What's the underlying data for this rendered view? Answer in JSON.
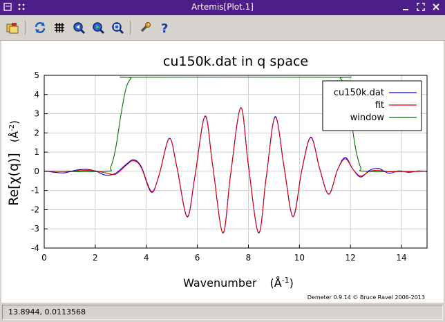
{
  "window": {
    "title": "Artemis[Plot.1]"
  },
  "toolbar": {
    "tools": [
      "open-files-icon",
      "refresh-icon",
      "grid-icon",
      "zoom-left-icon",
      "zoom-right-icon",
      "zoom-fit-icon",
      "settings-wrench-icon",
      "help-icon"
    ]
  },
  "status": {
    "coords": "13.8944,  0.0113568"
  },
  "colors": {
    "titlebar": "#4b1e8a",
    "data": "#0000ff",
    "fit": "#e00000",
    "window": "#007000"
  },
  "chart_data": {
    "type": "line",
    "title": "cu150k.dat in q space",
    "xlabel_main": "Wavenumber",
    "xlabel_unit_base": "(Å",
    "xlabel_unit_sup": "-1",
    "xlabel_unit_end": ")",
    "ylabel_main": "Re[χ(q)]",
    "ylabel_unit_base": "(Å",
    "ylabel_unit_sup": "-2",
    "ylabel_unit_end": ")",
    "xlim": [
      0,
      15
    ],
    "ylim": [
      -4,
      5
    ],
    "xticks": [
      0,
      2,
      4,
      6,
      8,
      10,
      12,
      14
    ],
    "yticks": [
      -4,
      -3,
      -2,
      -1,
      0,
      1,
      2,
      3,
      4,
      5
    ],
    "grid": true,
    "legend_position": "top-right",
    "credit": "Demeter 0.9.14 © Bruce Ravel 2006-2013",
    "series": [
      {
        "name": "cu150k.dat",
        "color": "#0000ff",
        "x": [
          0,
          0.4,
          0.8,
          1.2,
          1.6,
          2.0,
          2.4,
          2.8,
          3.2,
          3.5,
          3.8,
          4.2,
          4.5,
          4.9,
          5.2,
          5.6,
          5.9,
          6.3,
          6.6,
          7.0,
          7.3,
          7.7,
          8.0,
          8.4,
          8.7,
          9.05,
          9.4,
          9.75,
          10.1,
          10.45,
          10.8,
          11.15,
          11.5,
          11.8,
          12.1,
          12.4,
          12.75,
          13.1,
          13.5,
          13.9,
          14.3,
          14.7,
          15
        ],
        "y": [
          0.02,
          -0.05,
          -0.08,
          0.05,
          0.1,
          0.02,
          -0.2,
          -0.1,
          0.35,
          0.6,
          0.25,
          -1.05,
          -0.2,
          1.72,
          0.2,
          -2.35,
          -0.3,
          2.88,
          0.3,
          -3.2,
          -0.2,
          3.32,
          0.3,
          -3.2,
          -0.3,
          2.85,
          0.2,
          -2.35,
          0.1,
          1.78,
          0.1,
          -1.2,
          0.1,
          0.72,
          0.1,
          -0.3,
          0.05,
          0.15,
          -0.1,
          0.02,
          -0.05,
          0.02,
          -0.02
        ]
      },
      {
        "name": "fit",
        "color": "#e00000",
        "x": [
          0,
          0.4,
          0.8,
          1.2,
          1.6,
          2.0,
          2.4,
          2.8,
          3.2,
          3.5,
          3.8,
          4.2,
          4.5,
          4.9,
          5.2,
          5.6,
          5.9,
          6.3,
          6.6,
          7.0,
          7.3,
          7.7,
          8.0,
          8.4,
          8.7,
          9.05,
          9.4,
          9.75,
          10.1,
          10.45,
          10.8,
          11.15,
          11.5,
          11.8,
          12.1,
          12.4,
          12.75,
          13.1,
          13.5,
          13.9,
          14.3,
          14.7,
          15
        ],
        "y": [
          0.0,
          0.0,
          0.0,
          0.02,
          0.05,
          0.02,
          -0.08,
          -0.15,
          0.3,
          0.55,
          0.2,
          -1.1,
          -0.2,
          1.7,
          0.2,
          -2.38,
          -0.3,
          2.85,
          0.3,
          -3.22,
          -0.2,
          3.3,
          0.3,
          -3.22,
          -0.3,
          2.82,
          0.2,
          -2.38,
          0.1,
          1.75,
          0.1,
          -1.18,
          0.1,
          0.65,
          0.1,
          -0.25,
          0.0,
          0.05,
          -0.02,
          0.0,
          -0.02,
          0.0,
          0.0
        ]
      },
      {
        "name": "window",
        "color": "#007000",
        "x": [
          0,
          2.4,
          2.6,
          2.8,
          3.0,
          3.2,
          3.4,
          3.6,
          11.4,
          11.6,
          11.8,
          12.0,
          12.2,
          12.4,
          12.6,
          15
        ],
        "y": [
          0,
          0,
          0.2,
          1.2,
          2.9,
          4.3,
          4.85,
          4.9,
          4.9,
          4.85,
          4.3,
          2.9,
          1.2,
          0.2,
          0,
          0
        ]
      }
    ]
  }
}
